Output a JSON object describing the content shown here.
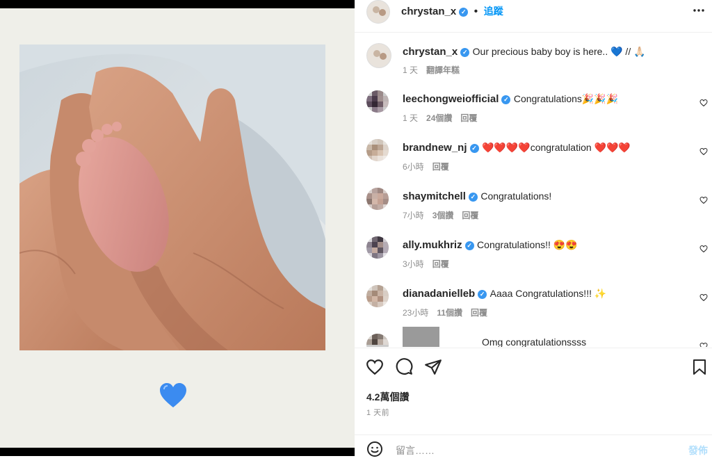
{
  "post": {
    "emoji": "💙"
  },
  "header": {
    "username": "chrystan_x",
    "verified_mark": "✓",
    "dot": "•",
    "follow_label": "追蹤",
    "more_icon": "more-horizontal-icon"
  },
  "caption": {
    "username": "chrystan_x",
    "text": "Our precious baby boy is here.. 💙 // 🙏🏻",
    "time": "1 天",
    "translate_label": "翻譯年糕"
  },
  "comments": [
    {
      "username": "leechongweiofficial",
      "text": "Congratulations🎉🎉🎉",
      "time": "1 天",
      "likes": "24個讚",
      "reply": "回覆"
    },
    {
      "username": "brandnew_nj",
      "text": "❤️❤️❤️❤️congratulation ❤️❤️❤️",
      "time": "6小時",
      "likes": "",
      "reply": "回覆"
    },
    {
      "username": "shaymitchell",
      "text": "Congratulations!",
      "time": "7小時",
      "likes": "3個讚",
      "reply": "回覆"
    },
    {
      "username": "ally.mukhriz",
      "text": "Congratulations!! 😍😍",
      "time": "3小時",
      "likes": "",
      "reply": "回覆"
    },
    {
      "username": "dianadanielleb",
      "text": "Aaaa Congratulations!!! ✨",
      "time": "23小時",
      "likes": "11個讚",
      "reply": "回覆"
    },
    {
      "username": "",
      "text": "Omg congratulationssss",
      "time": "",
      "likes": "",
      "reply": ""
    }
  ],
  "footer": {
    "likes_count": "4.2萬個讚",
    "posted_ago": "1 天前",
    "comment_placeholder": "留言……",
    "post_label": "發佈"
  },
  "colors": {
    "accent": "#0095f6",
    "verified": "#3897f0",
    "text": "#262626",
    "muted": "#8e8e8e",
    "post_disabled": "#b2dffc"
  }
}
